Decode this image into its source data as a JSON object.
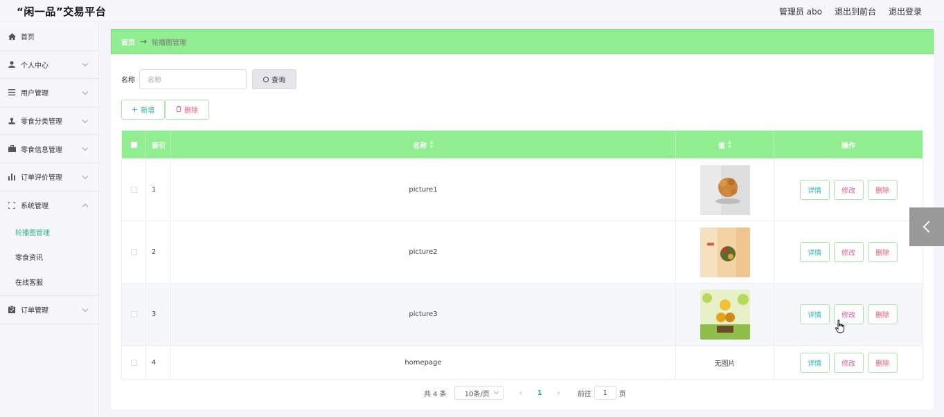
{
  "header": {
    "brand": "“闲一品”交易平台",
    "admin_label": "管理员 abo",
    "back_front": "退出到前台",
    "logout": "退出登录"
  },
  "sidebar": {
    "items": [
      {
        "label": "首页",
        "icon": "home-icon"
      },
      {
        "label": "个人中心",
        "icon": "user-icon"
      },
      {
        "label": "用户管理",
        "icon": "list-icon"
      },
      {
        "label": "零食分类管理",
        "icon": "stamp-icon"
      },
      {
        "label": "零食信息管理",
        "icon": "briefcase-icon"
      },
      {
        "label": "订单评价管理",
        "icon": "bar-chart-icon"
      },
      {
        "label": "系统管理",
        "icon": "frame-icon"
      }
    ],
    "system_sub": [
      "轮播图管理",
      "零食资讯",
      "在线客服"
    ],
    "order": {
      "label": "订单管理",
      "icon": "clipboard-icon"
    }
  },
  "breadcrumb": {
    "home": "首页",
    "arrow": "→",
    "current": "轮播图管理"
  },
  "search": {
    "label": "名称",
    "placeholder": "名称",
    "button": "查询"
  },
  "actions": {
    "add": "新增",
    "delete": "删除"
  },
  "table": {
    "headers": {
      "index": "索引",
      "name": "名称",
      "value": "值",
      "ops": "操作"
    },
    "rows": [
      {
        "index": "1",
        "name": "picture1",
        "value": "",
        "has_image": true
      },
      {
        "index": "2",
        "name": "picture2",
        "value": "",
        "has_image": true
      },
      {
        "index": "3",
        "name": "picture3",
        "value": "",
        "has_image": true
      },
      {
        "index": "4",
        "name": "homepage",
        "value": "无图片",
        "has_image": false
      }
    ],
    "op_labels": {
      "detail": "详情",
      "edit": "修改",
      "delete": "删除"
    }
  },
  "pagination": {
    "total": "共 4 条",
    "page_size": "10条/页",
    "current_page": "1",
    "goto_label": "前往",
    "goto_value": "1",
    "page_suffix": "页"
  },
  "colors": {
    "accent_green": "#90ee90",
    "active_text": "#2bb58c",
    "delete_red": "#e05c73"
  }
}
